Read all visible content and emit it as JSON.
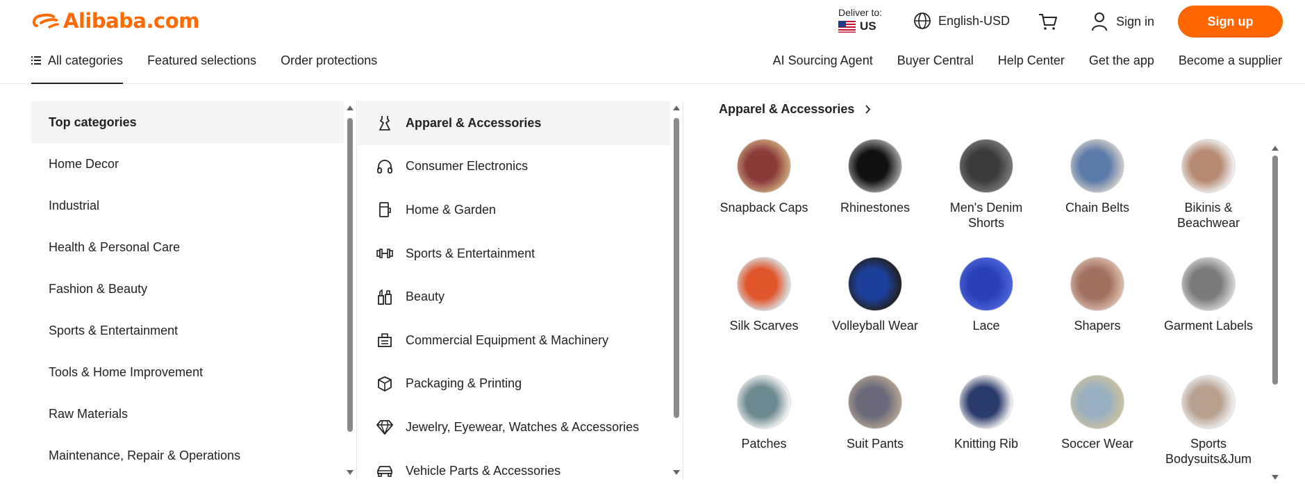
{
  "brand": {
    "name": "Alibaba.com",
    "color": "#ff6a00"
  },
  "header": {
    "deliver_label": "Deliver to:",
    "deliver_country": "US",
    "language": "English-USD",
    "signin": "Sign in",
    "signup": "Sign up"
  },
  "nav": {
    "left": [
      "All categories",
      "Featured selections",
      "Order protections"
    ],
    "right": [
      "AI Sourcing Agent",
      "Buyer Central",
      "Help Center",
      "Get the app",
      "Become a supplier"
    ]
  },
  "top_categories": {
    "heading": "Top categories",
    "items": [
      "Home Decor",
      "Industrial",
      "Health & Personal Care",
      "Fashion & Beauty",
      "Sports & Entertainment",
      "Tools & Home Improvement",
      "Raw Materials",
      "Maintenance, Repair & Operations"
    ]
  },
  "categories": [
    {
      "label": "Apparel & Accessories",
      "icon": "dress-icon",
      "active": true
    },
    {
      "label": "Consumer Electronics",
      "icon": "headphones-icon"
    },
    {
      "label": "Home & Garden",
      "icon": "appliance-icon"
    },
    {
      "label": "Sports & Entertainment",
      "icon": "dumbbell-icon"
    },
    {
      "label": "Beauty",
      "icon": "cosmetics-icon"
    },
    {
      "label": "Commercial Equipment & Machinery",
      "icon": "cash-register-icon"
    },
    {
      "label": "Packaging & Printing",
      "icon": "box-icon"
    },
    {
      "label": "Jewelry, Eyewear, Watches & Accessories",
      "icon": "diamond-icon"
    },
    {
      "label": "Vehicle Parts & Accessories",
      "icon": "car-icon"
    }
  ],
  "subcategory_panel": {
    "title": "Apparel & Accessories",
    "items": [
      {
        "label": "Snapback Caps",
        "colors": [
          "#8b3a3a",
          "#c9a27a"
        ]
      },
      {
        "label": "Rhinestones",
        "colors": [
          "#111111",
          "#9a9a9a"
        ]
      },
      {
        "label": "Men's Denim Shorts",
        "colors": [
          "#3a3a3a",
          "#777777"
        ]
      },
      {
        "label": "Chain Belts",
        "colors": [
          "#5a7aa8",
          "#c8c8c8"
        ]
      },
      {
        "label": "Bikinis & Beachwear",
        "colors": [
          "#b58a70",
          "#eeeeee"
        ]
      },
      {
        "label": "Silk Scarves",
        "colors": [
          "#e0552a",
          "#d9d9d9"
        ]
      },
      {
        "label": "Volleyball Wear",
        "colors": [
          "#1d3f9c",
          "#222222"
        ]
      },
      {
        "label": "Lace",
        "colors": [
          "#2a3fb8",
          "#4a64d9"
        ]
      },
      {
        "label": "Shapers",
        "colors": [
          "#a07060",
          "#d8b8a8"
        ]
      },
      {
        "label": "Garment Labels",
        "colors": [
          "#7a7a7a",
          "#d0d0d0"
        ]
      },
      {
        "label": "Patches",
        "colors": [
          "#6c8a90",
          "#f0f0f0"
        ]
      },
      {
        "label": "Suit Pants",
        "colors": [
          "#6a6a7a",
          "#b0a090"
        ]
      },
      {
        "label": "Knitting Rib",
        "colors": [
          "#2a3a6a",
          "#eeeeee"
        ]
      },
      {
        "label": "Soccer Wear",
        "colors": [
          "#9ab0c0",
          "#c8c0a0"
        ]
      },
      {
        "label": "Sports Bodysuits&Jum",
        "colors": [
          "#b8a090",
          "#eeeeee"
        ]
      }
    ]
  }
}
